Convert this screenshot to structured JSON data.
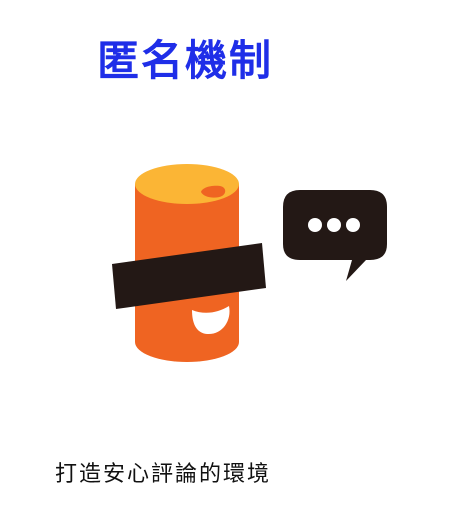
{
  "title": "匿名機制",
  "caption": "打造安心評論的環境",
  "colors": {
    "title": "#1f2ee8",
    "cylinder_body": "#ef6422",
    "cylinder_top": "#fbb535",
    "censor_bar": "#231815",
    "speech_bubble": "#231815",
    "smile": "#ffffff"
  },
  "illustration": {
    "main_icon": "anonymous-mascot-icon",
    "bubble_icon": "speech-bubble-ellipsis-icon"
  }
}
